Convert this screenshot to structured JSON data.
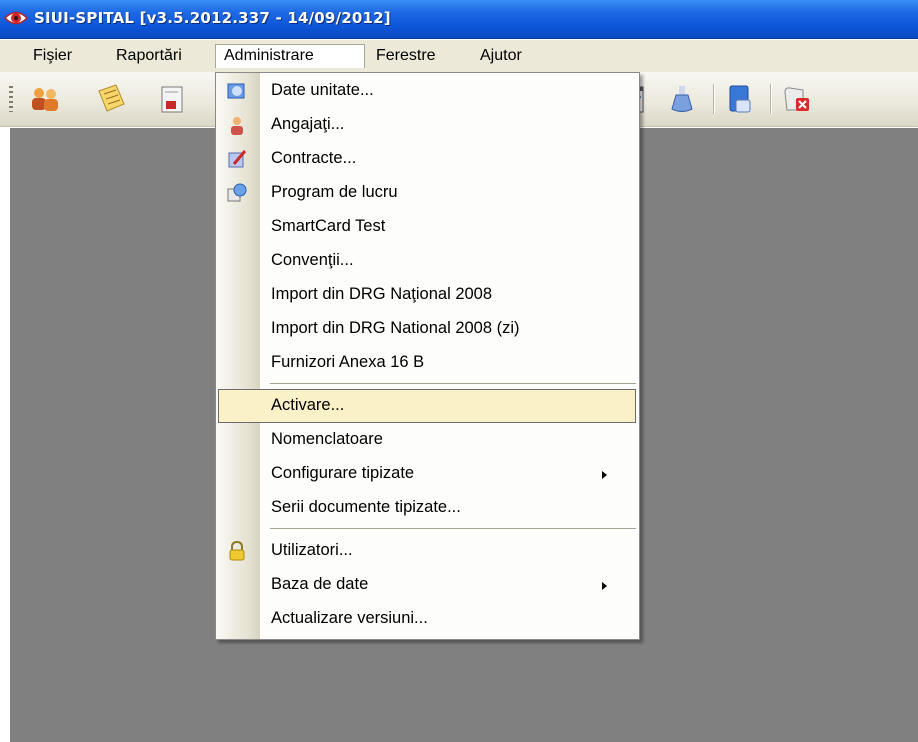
{
  "window": {
    "title": "SIUI-SPITAL [v3.5.2012.337 - 14/09/2012]",
    "app_icon": "eye-icon"
  },
  "menubar": {
    "items": [
      {
        "label": "Fişier"
      },
      {
        "label": "Raportări"
      },
      {
        "label": "Administrare",
        "active": true
      },
      {
        "label": "Ferestre"
      },
      {
        "label": "Ajutor"
      }
    ]
  },
  "toolbar": {
    "icons": [
      "users-icon",
      "notes-icon",
      "document-icon",
      "export-icon",
      "checklist-icon",
      "flask-icon",
      "report-icon",
      "close-document-icon"
    ]
  },
  "dropdown": {
    "menu": "Administrare",
    "items": [
      {
        "label": "Date unitate...",
        "icon": "globe-icon"
      },
      {
        "label": "Angajaţi...",
        "icon": "person-icon"
      },
      {
        "label": "Contracte...",
        "icon": "contract-icon"
      },
      {
        "label": "Program de lucru",
        "icon": "schedule-icon"
      },
      {
        "label": "SmartCard Test"
      },
      {
        "label": "Convenţii..."
      },
      {
        "label": "Import din DRG Naţional 2008"
      },
      {
        "label": "Import din DRG National 2008 (zi)"
      },
      {
        "label": "Furnizori Anexa 16 B"
      },
      {
        "label": "Activare...",
        "selected": true
      },
      {
        "label": "Nomenclatoare"
      },
      {
        "label": "Configurare tipizate",
        "submenu": true
      },
      {
        "label": "Serii documente tipizate..."
      },
      {
        "label": "Utilizatori...",
        "icon": "lock-icon"
      },
      {
        "label": "Baza de date",
        "submenu": true
      },
      {
        "label": "Actualizare versiuni..."
      }
    ]
  },
  "colors": {
    "titlebar": "#0d55d8",
    "menubar": "#ece9d8",
    "workspace": "#808080",
    "highlight": "#fbf1c8"
  }
}
